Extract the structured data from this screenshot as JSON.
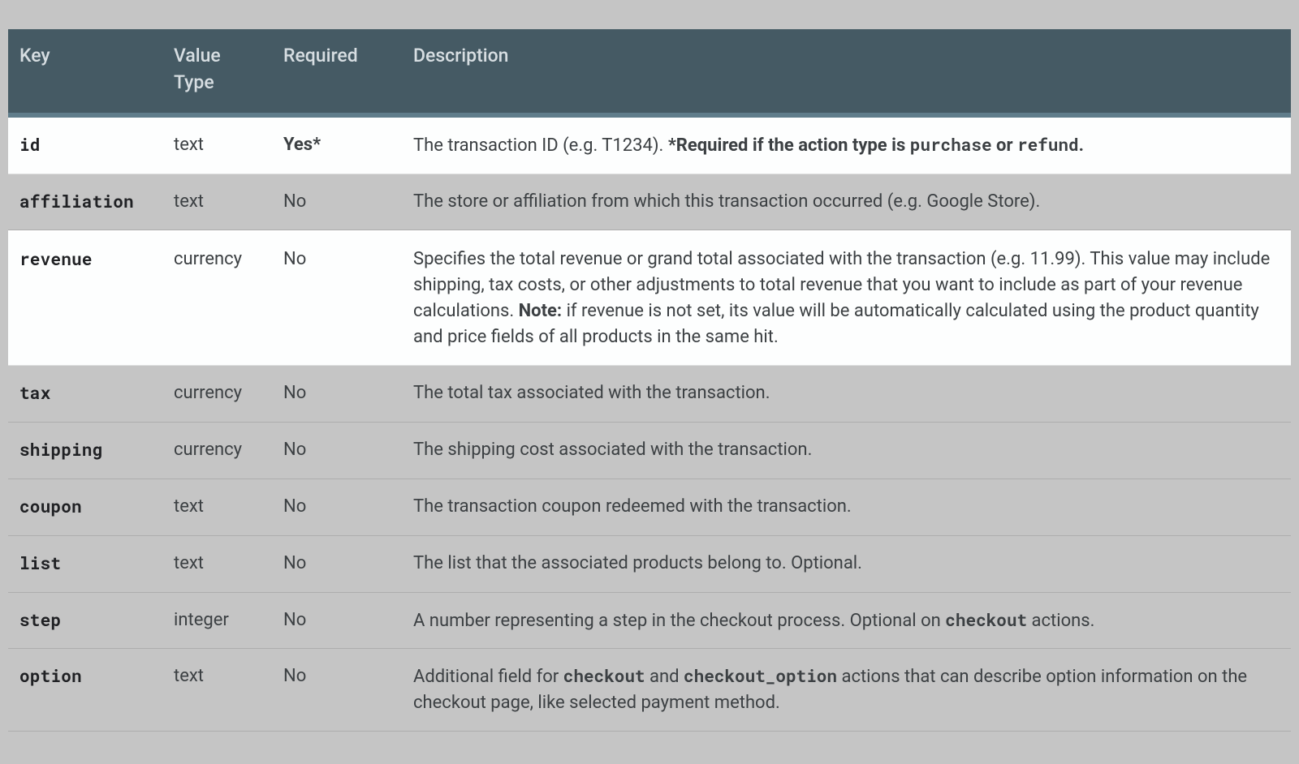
{
  "columns": {
    "key": "Key",
    "value_type": "Value Type",
    "required": "Required",
    "description": "Description"
  },
  "rows": [
    {
      "key": "id",
      "value_type": "text",
      "required": "Yes*",
      "required_bold": true,
      "highlight": true,
      "desc_pre": "The transaction ID (e.g. T1234). ",
      "desc_bold1": "*Required if the action type is ",
      "desc_code1": "purchase",
      "desc_bold2": " or ",
      "desc_code2": "refund",
      "desc_bold3": ".",
      "desc_post": ""
    },
    {
      "key": "affiliation",
      "value_type": "text",
      "required": "No",
      "required_bold": false,
      "highlight": false,
      "desc_pre": "The store or affiliation from which this transaction occurred (e.g. Google Store).",
      "desc_post": ""
    },
    {
      "key": "revenue",
      "value_type": "currency",
      "required": "No",
      "required_bold": false,
      "highlight": true,
      "desc_pre": "Specifies the total revenue or grand total associated with the transaction (e.g. 11.99). This value may include shipping, tax costs, or other adjustments to total revenue that you want to include as part of your revenue calculations. ",
      "desc_bold1": "Note:",
      "desc_post": " if revenue is not set, its value will be automatically calculated using the product quantity and price fields of all products in the same hit."
    },
    {
      "key": "tax",
      "value_type": "currency",
      "required": "No",
      "required_bold": false,
      "highlight": false,
      "desc_pre": "The total tax associated with the transaction.",
      "desc_post": ""
    },
    {
      "key": "shipping",
      "value_type": "currency",
      "required": "No",
      "required_bold": false,
      "highlight": false,
      "desc_pre": "The shipping cost associated with the transaction.",
      "desc_post": ""
    },
    {
      "key": "coupon",
      "value_type": "text",
      "required": "No",
      "required_bold": false,
      "highlight": false,
      "desc_pre": "The transaction coupon redeemed with the transaction.",
      "desc_post": ""
    },
    {
      "key": "list",
      "value_type": "text",
      "required": "No",
      "required_bold": false,
      "highlight": false,
      "desc_pre": "The list that the associated products belong to. Optional.",
      "desc_post": ""
    },
    {
      "key": "step",
      "value_type": "integer",
      "required": "No",
      "required_bold": false,
      "highlight": false,
      "desc_pre": "A number representing a step in the checkout process. Optional on ",
      "desc_bold1": "checkout",
      "desc_post": " actions."
    },
    {
      "key": "option",
      "value_type": "text",
      "required": "No",
      "required_bold": false,
      "highlight": false,
      "desc_pre": "Additional field for ",
      "desc_bold1": "checkout",
      "desc_mid": " and ",
      "desc_bold2_plain": "checkout_option",
      "desc_post": " actions that can describe option information on the checkout page, like selected payment method."
    }
  ]
}
